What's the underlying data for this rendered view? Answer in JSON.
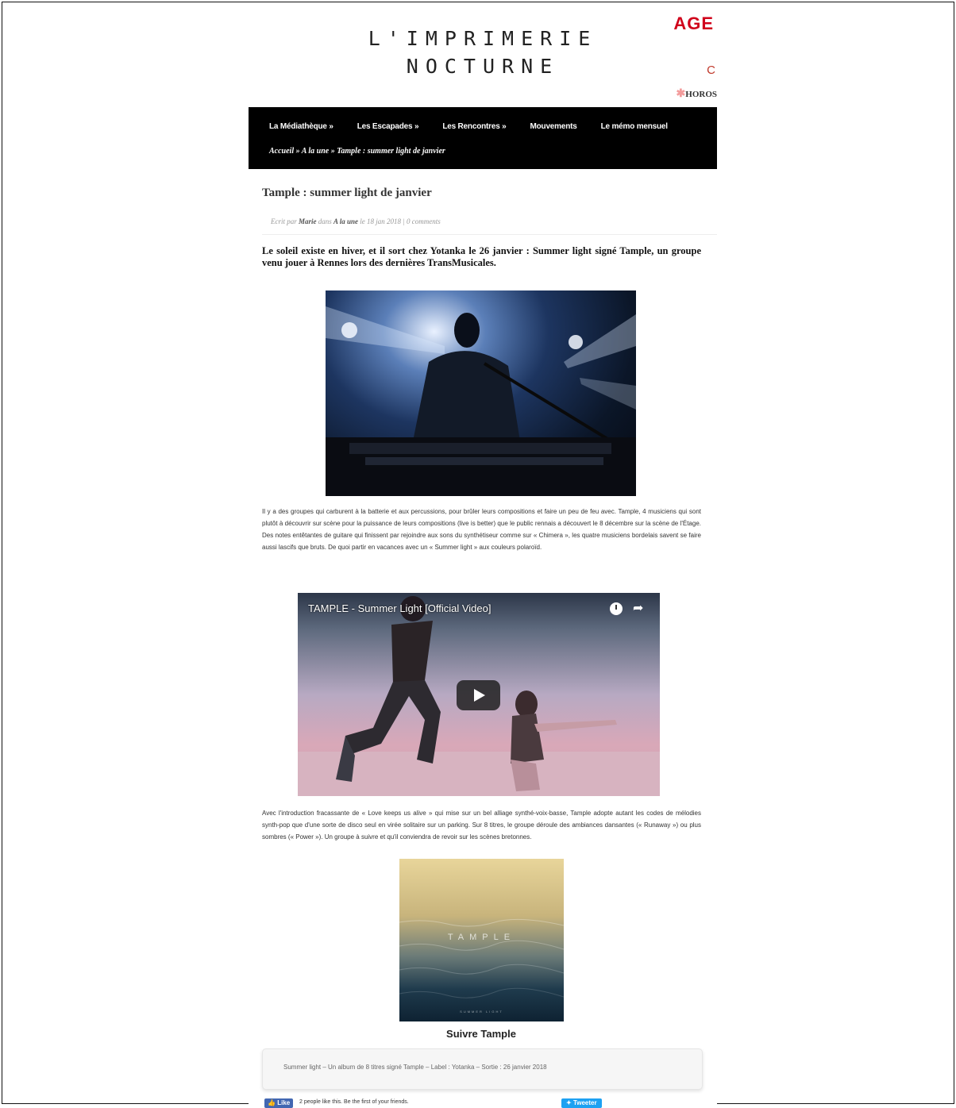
{
  "header": {
    "site_title_line1": "L'IMPRIMERIE",
    "site_title_line2": "NOCTURNE",
    "agenda_label": "AGE",
    "side_letter": "C",
    "horoscope_label": "HOROS"
  },
  "nav": {
    "items": [
      "La Médiathèque »",
      "Les Escapades »",
      "Les Rencontres »",
      "Mouvements",
      "Le mémo mensuel"
    ],
    "breadcrumb": "Accueil » A la une » Tample : summer light de janvier"
  },
  "article": {
    "title": "Tample : summer light de janvier",
    "meta_prefix": "Ecrit par",
    "meta_author": "Marie",
    "meta_in": "dans",
    "meta_category": "A la une",
    "meta_date": "le 18 jan 2018 |",
    "meta_comments": "0 comments",
    "lead": "Le soleil existe en hiver, et il sort chez Yotanka le 26 janvier : Summer light signé Tample, un groupe venu jouer à Rennes lors des dernières TransMusicales.",
    "paragraph1": "Il y a des groupes qui carburent à la batterie et aux percussions, pour brûler leurs compositions et faire un peu de feu avec. Tample, 4 musiciens qui sont plutôt à découvrir sur scène pour la puissance de leurs compositions (live is better) que le public rennais a découvert le 8 décembre sur la scène de l'Étage. Des notes entêtantes de guitare qui finissent par rejoindre aux sons du synthétiseur comme sur « Chimera », les quatre musiciens bordelais savent se faire aussi lascifs que bruts. De quoi partir en vacances avec un « Summer light » aux couleurs polaroïd.",
    "video_title": "TAMPLE - Summer Light [Official Video]",
    "paragraph2": "Avec l'introduction fracassante de « Love keeps us alive » qui mise sur un bel alliage synthé-voix-basse, Tample adopte autant les codes de mélodies synth-pop que d'une sorte de disco seul en virée solitaire sur un parking. Sur 8 titres, le groupe déroule des ambiances dansantes (« Runaway ») ou plus sombres (« Power »). Un groupe à suivre et qu'il conviendra de revoir sur les scènes bretonnes.",
    "album_word": "TAMPLE",
    "album_sub": "SUMMER LIGHT",
    "follow_label": "Suivre Tample",
    "infobox": "Summer light – Un album de 8 titres signé Tample – Label : Yotanka – Sortie : 26 janvier 2018"
  },
  "social": {
    "like_label": "Like",
    "like_text": "2 people like this. Be the first of your friends.",
    "tweet_label": "Tweeter"
  },
  "colors": {
    "accent": "#d0021b",
    "nav_bg": "#000000",
    "facebook": "#4267b2",
    "twitter": "#1da1f2"
  },
  "icons": [
    "play-icon",
    "clock-icon",
    "share-icon",
    "star-icon",
    "facebook-icon",
    "twitter-icon"
  ]
}
